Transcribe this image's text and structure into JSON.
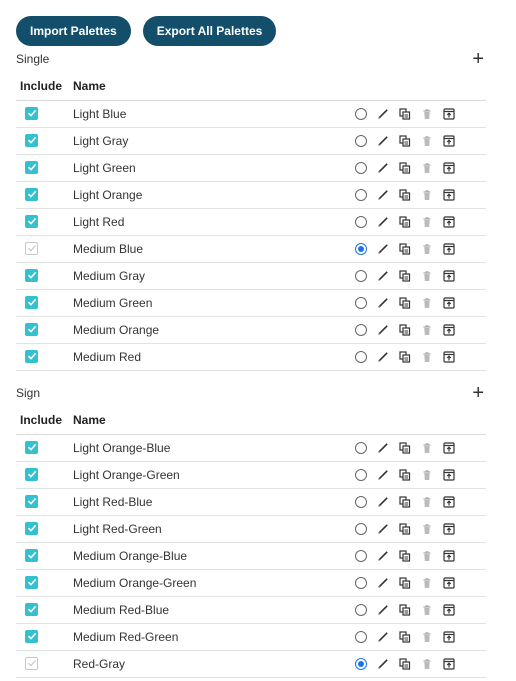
{
  "toolbar": {
    "import_label": "Import Palettes",
    "export_label": "Export All Palettes"
  },
  "colors": {
    "accent": "#134f6b",
    "checkbox": "#35c0cf",
    "radio_selected": "#1a73e8"
  },
  "icons": [
    "radio-icon",
    "edit-pencil-icon",
    "duplicate-icon",
    "delete-trash-icon",
    "export-icon"
  ],
  "sections": [
    {
      "title": "Single",
      "add_label": "+",
      "col_include": "Include",
      "col_name": "Name",
      "rows": [
        {
          "name": "Light Blue",
          "included": true,
          "default": false
        },
        {
          "name": "Light Gray",
          "included": true,
          "default": false
        },
        {
          "name": "Light Green",
          "included": true,
          "default": false
        },
        {
          "name": "Light Orange",
          "included": true,
          "default": false
        },
        {
          "name": "Light Red",
          "included": true,
          "default": false
        },
        {
          "name": "Medium Blue",
          "included": false,
          "default": true
        },
        {
          "name": "Medium Gray",
          "included": true,
          "default": false
        },
        {
          "name": "Medium Green",
          "included": true,
          "default": false
        },
        {
          "name": "Medium Orange",
          "included": true,
          "default": false
        },
        {
          "name": "Medium Red",
          "included": true,
          "default": false
        }
      ]
    },
    {
      "title": "Sign",
      "add_label": "+",
      "col_include": "Include",
      "col_name": "Name",
      "rows": [
        {
          "name": "Light Orange-Blue",
          "included": true,
          "default": false
        },
        {
          "name": "Light Orange-Green",
          "included": true,
          "default": false
        },
        {
          "name": "Light Red-Blue",
          "included": true,
          "default": false
        },
        {
          "name": "Light Red-Green",
          "included": true,
          "default": false
        },
        {
          "name": "Medium Orange-Blue",
          "included": true,
          "default": false
        },
        {
          "name": "Medium Orange-Green",
          "included": true,
          "default": false
        },
        {
          "name": "Medium Red-Blue",
          "included": true,
          "default": false
        },
        {
          "name": "Medium Red-Green",
          "included": true,
          "default": false
        },
        {
          "name": "Red-Gray",
          "included": false,
          "default": true
        }
      ]
    }
  ]
}
